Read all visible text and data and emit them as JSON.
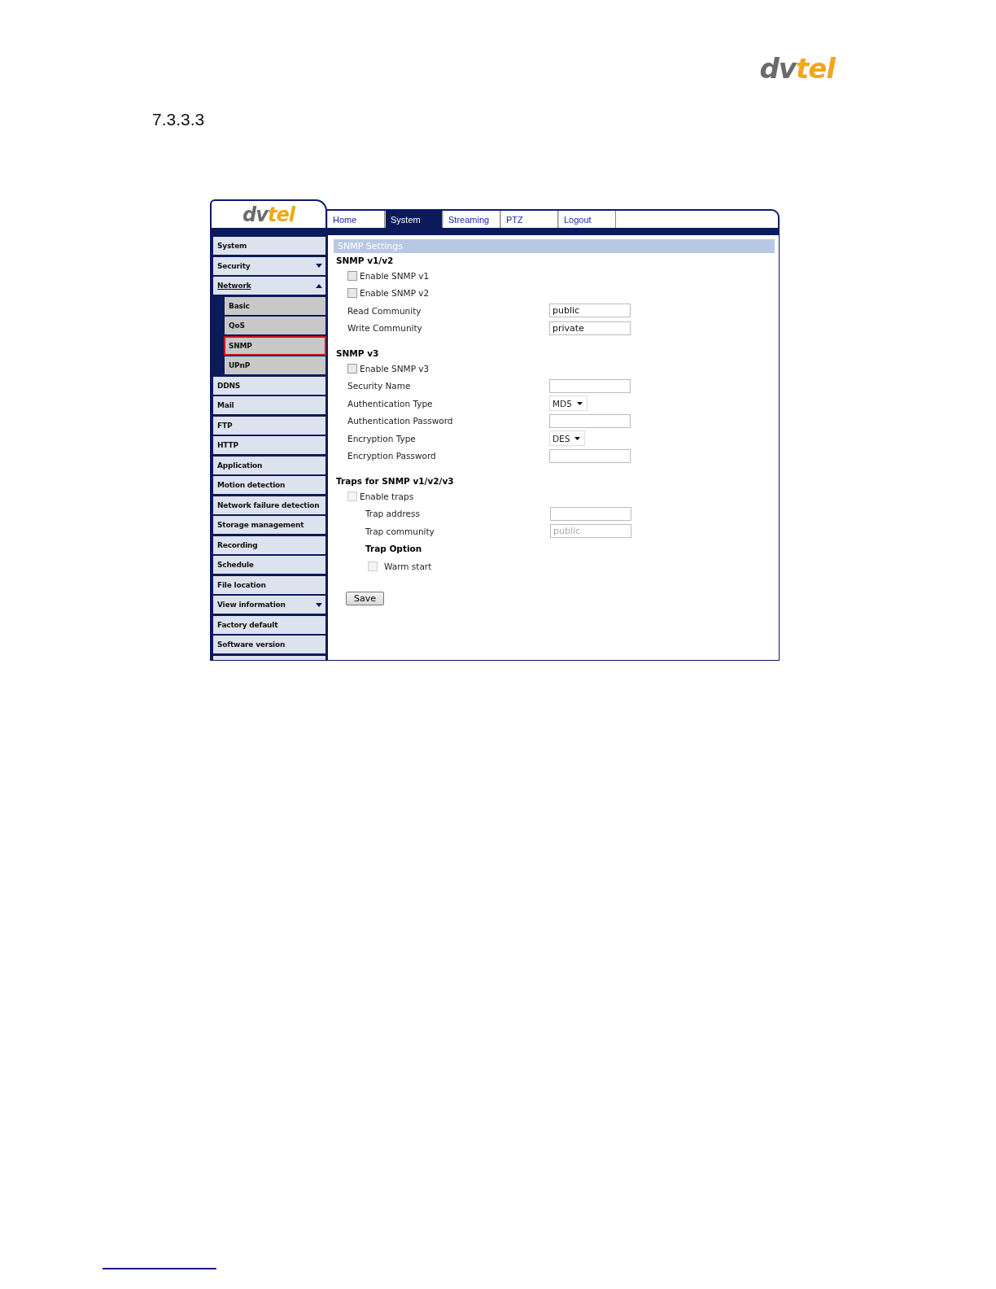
{
  "page_logo": {
    "dark": "dv",
    "accent": "tel"
  },
  "section_number": "7.3.3.3",
  "app": {
    "logo": {
      "dark": "dv",
      "accent": "tel"
    },
    "tabs": [
      {
        "label": "Home",
        "selected": false
      },
      {
        "label": "System",
        "selected": true
      },
      {
        "label": "Streaming",
        "selected": false
      },
      {
        "label": "PTZ",
        "selected": false
      },
      {
        "label": "Logout",
        "selected": false
      }
    ],
    "sidebar": {
      "items": [
        {
          "label": "System",
          "selected": false
        },
        {
          "label": "Security",
          "selected": false,
          "expanded": false
        },
        {
          "label": "Network",
          "selected": false,
          "expanded": true,
          "children": [
            {
              "label": "Basic",
              "selected": false
            },
            {
              "label": "QoS",
              "selected": false
            },
            {
              "label": "SNMP",
              "selected": true
            },
            {
              "label": "UPnP",
              "selected": false
            }
          ]
        },
        {
          "label": "DDNS",
          "selected": false
        },
        {
          "label": "Mail",
          "selected": false
        },
        {
          "label": "FTP",
          "selected": false
        },
        {
          "label": "HTTP",
          "selected": false
        },
        {
          "label": "Application",
          "selected": false
        },
        {
          "label": "Motion detection",
          "selected": false
        },
        {
          "label": "Network failure detection",
          "selected": false
        },
        {
          "label": "Storage management",
          "selected": false
        },
        {
          "label": "Recording",
          "selected": false
        },
        {
          "label": "Schedule",
          "selected": false
        },
        {
          "label": "File location",
          "selected": false
        },
        {
          "label": "View information",
          "selected": false,
          "expanded": false
        },
        {
          "label": "Factory default",
          "selected": false
        },
        {
          "label": "Software version",
          "selected": false
        }
      ]
    },
    "panel": {
      "title": "SNMP Settings",
      "sections": [
        {
          "heading": "SNMP v1/v2",
          "rows": [
            {
              "kind": "checkbox",
              "label": "Enable SNMP v1",
              "checked": false,
              "disabled": false
            },
            {
              "kind": "checkbox",
              "label": "Enable SNMP v2",
              "checked": false,
              "disabled": false
            },
            {
              "kind": "text",
              "label": "Read Community",
              "value": "public",
              "disabled": false
            },
            {
              "kind": "text",
              "label": "Write Community",
              "value": "private",
              "disabled": false
            }
          ]
        },
        {
          "heading": "SNMP v3",
          "rows": [
            {
              "kind": "checkbox",
              "label": "Enable SNMP v3",
              "checked": false,
              "disabled": false
            },
            {
              "kind": "text",
              "label": "Security Name"
            },
            {
              "kind": "select",
              "label": "Authentication Type",
              "value": "MD5"
            },
            {
              "kind": "text",
              "label": "Authentication Password"
            },
            {
              "kind": "select",
              "label": "Encryption Type",
              "value": "DES"
            },
            {
              "kind": "text",
              "label": "Encryption Password"
            }
          ]
        },
        {
          "heading": "Traps for SNMP v1/v2/v3",
          "rows": [
            {
              "kind": "checkbox",
              "label": "Enable traps",
              "checked": false,
              "disabled": true,
              "children": [
                {
                  "kind": "text",
                  "label": "Trap address"
                },
                {
                  "kind": "text",
                  "label": "Trap community",
                  "value": "public",
                  "disabled": true
                },
                {
                  "kind": "subheading",
                  "label": "Trap Option"
                },
                {
                  "kind": "checkbox",
                  "label": "Warm start",
                  "checked": false,
                  "disabled": true
                }
              ]
            }
          ]
        }
      ],
      "save_button": "Save"
    }
  }
}
